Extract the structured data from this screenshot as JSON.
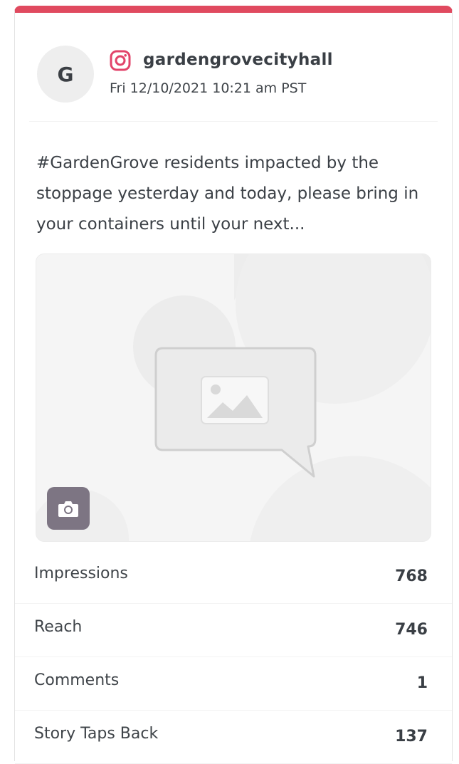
{
  "post": {
    "avatar_letter": "G",
    "platform_icon": "instagram-icon",
    "username": "gardengrovecityhall",
    "timestamp": "Fri 12/10/2021 10:21 am PST",
    "caption": "#GardenGrove residents impacted by the stoppage yesterday and today, please bring in your containers until your next...",
    "media_icon": "image-placeholder-icon",
    "media_badge_icon": "camera-icon"
  },
  "stats": [
    {
      "label": "Impressions",
      "value": "768"
    },
    {
      "label": "Reach",
      "value": "746"
    },
    {
      "label": "Comments",
      "value": "1"
    },
    {
      "label": "Story Taps Back",
      "value": "137"
    }
  ],
  "colors": {
    "accent_bar": "#e04a5f",
    "instagram": "#e2436a",
    "badge_bg": "#7d7583"
  }
}
